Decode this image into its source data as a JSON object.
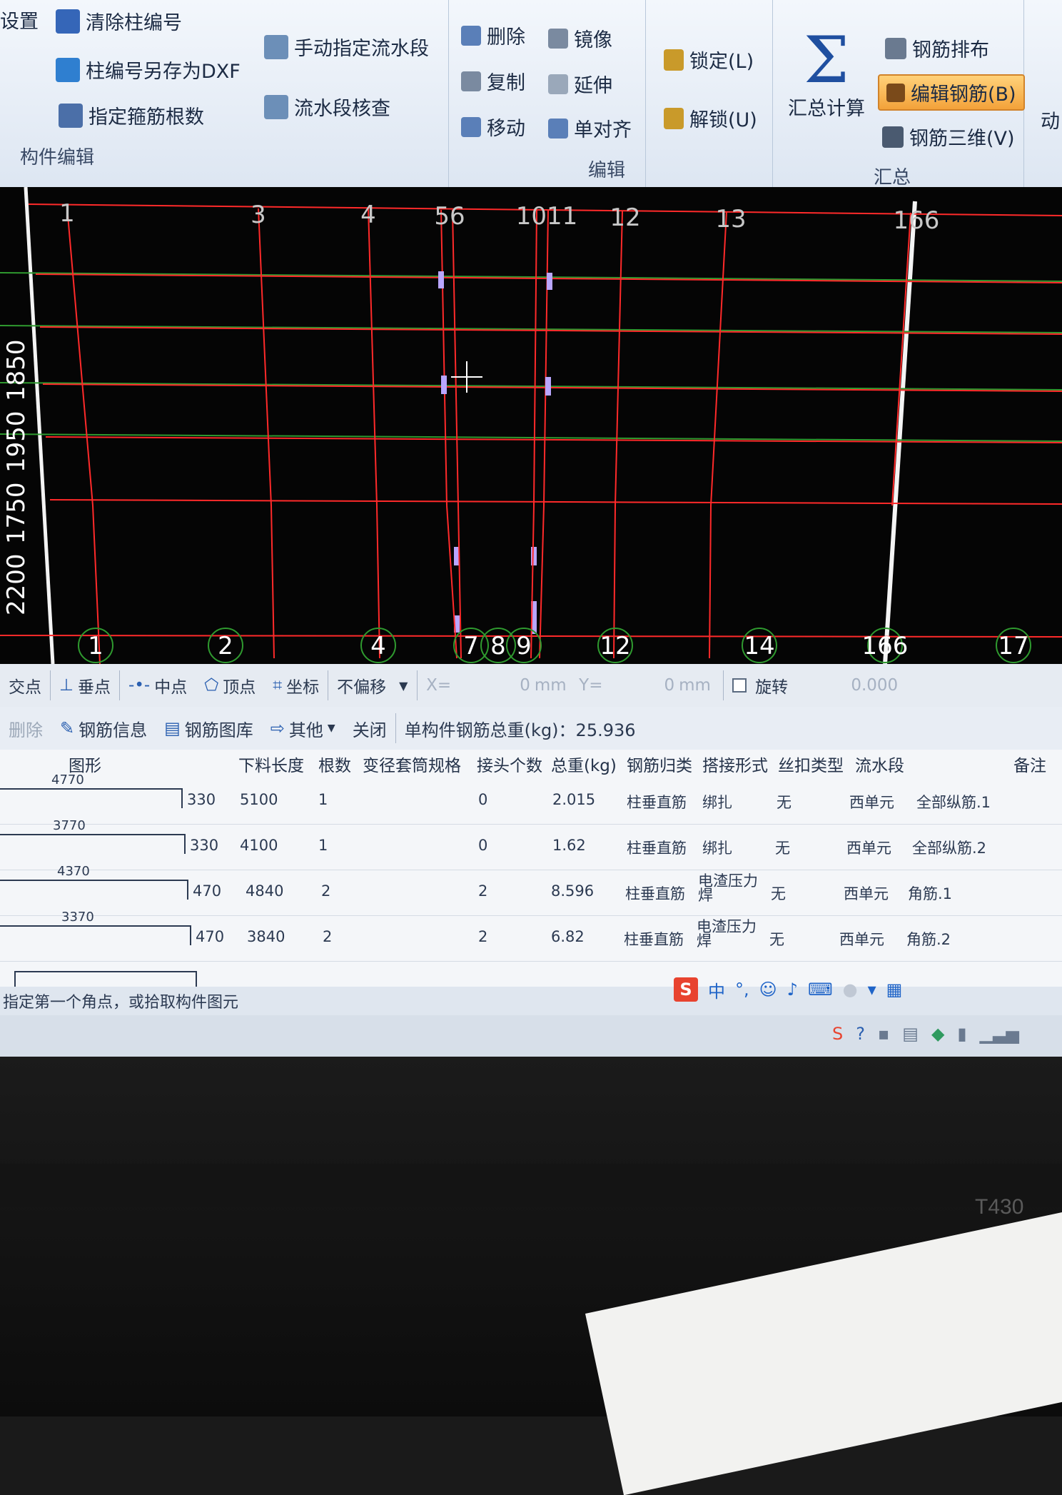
{
  "ribbon": {
    "group1": {
      "items": [
        "设置",
        "清除柱编号",
        "柱编号另存为DXF",
        "指定箍筋根数",
        "手动指定流水段",
        "流水段核查"
      ],
      "label": "构件编辑"
    },
    "group2": {
      "items": [
        "删除",
        "镜像",
        "复制",
        "延伸",
        "移动",
        "单对齐"
      ],
      "label": "编辑"
    },
    "lock": "锁定(L)",
    "unlock": "解锁(U)",
    "group3": {
      "calc": "汇总计算",
      "items": [
        "钢筋排布",
        "编辑钢筋(B)",
        "钢筋三维(V)"
      ],
      "label": "汇总"
    },
    "clipped": "动"
  },
  "canvas": {
    "top_axis": [
      "1",
      "3",
      "4",
      "56",
      "1011",
      "12",
      "13",
      "166"
    ],
    "bottom_axis": [
      "1",
      "2",
      "4",
      "7",
      "8",
      "9",
      "12",
      "14",
      "166",
      "17"
    ],
    "left_dims": [
      "2200",
      "1750",
      "1950",
      "1850"
    ]
  },
  "snapbar": {
    "items": [
      "交点",
      "垂点",
      "中点",
      "顶点",
      "坐标"
    ],
    "offset_mode": "不偏移",
    "x_label": "X=",
    "x_value": "0",
    "unit": "mm",
    "y_label": "Y=",
    "y_value": "0",
    "rotate_label": "旋转",
    "rotate_value": "0.000"
  },
  "rebarbar": {
    "delete": "删除",
    "info": "钢筋信息",
    "library": "钢筋图库",
    "other": "其他",
    "close": "关闭",
    "total_weight": "单构件钢筋总重(kg)：25.936"
  },
  "table": {
    "headers": [
      "图形",
      "下料长度",
      "根数",
      "变径套筒规格",
      "接头个数",
      "总重(kg)",
      "钢筋归类",
      "搭接形式",
      "丝扣类型",
      "流水段",
      "备注"
    ],
    "rows": [
      {
        "shape_top": "4770",
        "shape_side": "330",
        "length": "5100",
        "count": "1",
        "joints": "0",
        "weight": "2.015",
        "category": "柱垂直筋",
        "lap": "绑扎",
        "thread": "无",
        "segment": "西单元",
        "note": "全部纵筋.1"
      },
      {
        "shape_top": "3770",
        "shape_side": "330",
        "length": "4100",
        "count": "1",
        "joints": "0",
        "weight": "1.62",
        "category": "柱垂直筋",
        "lap": "绑扎",
        "thread": "无",
        "segment": "西单元",
        "note": "全部纵筋.2"
      },
      {
        "shape_top": "4370",
        "shape_side": "470",
        "length": "4840",
        "count": "2",
        "joints": "2",
        "weight": "8.596",
        "category": "柱垂直筋",
        "lap": "电渣压力焊",
        "thread": "无",
        "segment": "西单元",
        "note": "角筋.1"
      },
      {
        "shape_top": "3370",
        "shape_side": "470",
        "length": "3840",
        "count": "2",
        "joints": "2",
        "weight": "6.82",
        "category": "柱垂直筋",
        "lap": "电渣压力焊",
        "thread": "无",
        "segment": "西单元",
        "note": "角筋.2"
      }
    ]
  },
  "status": "指定第一个角点，或拾取构件图元",
  "ime": "中",
  "laptop_model": "T430"
}
